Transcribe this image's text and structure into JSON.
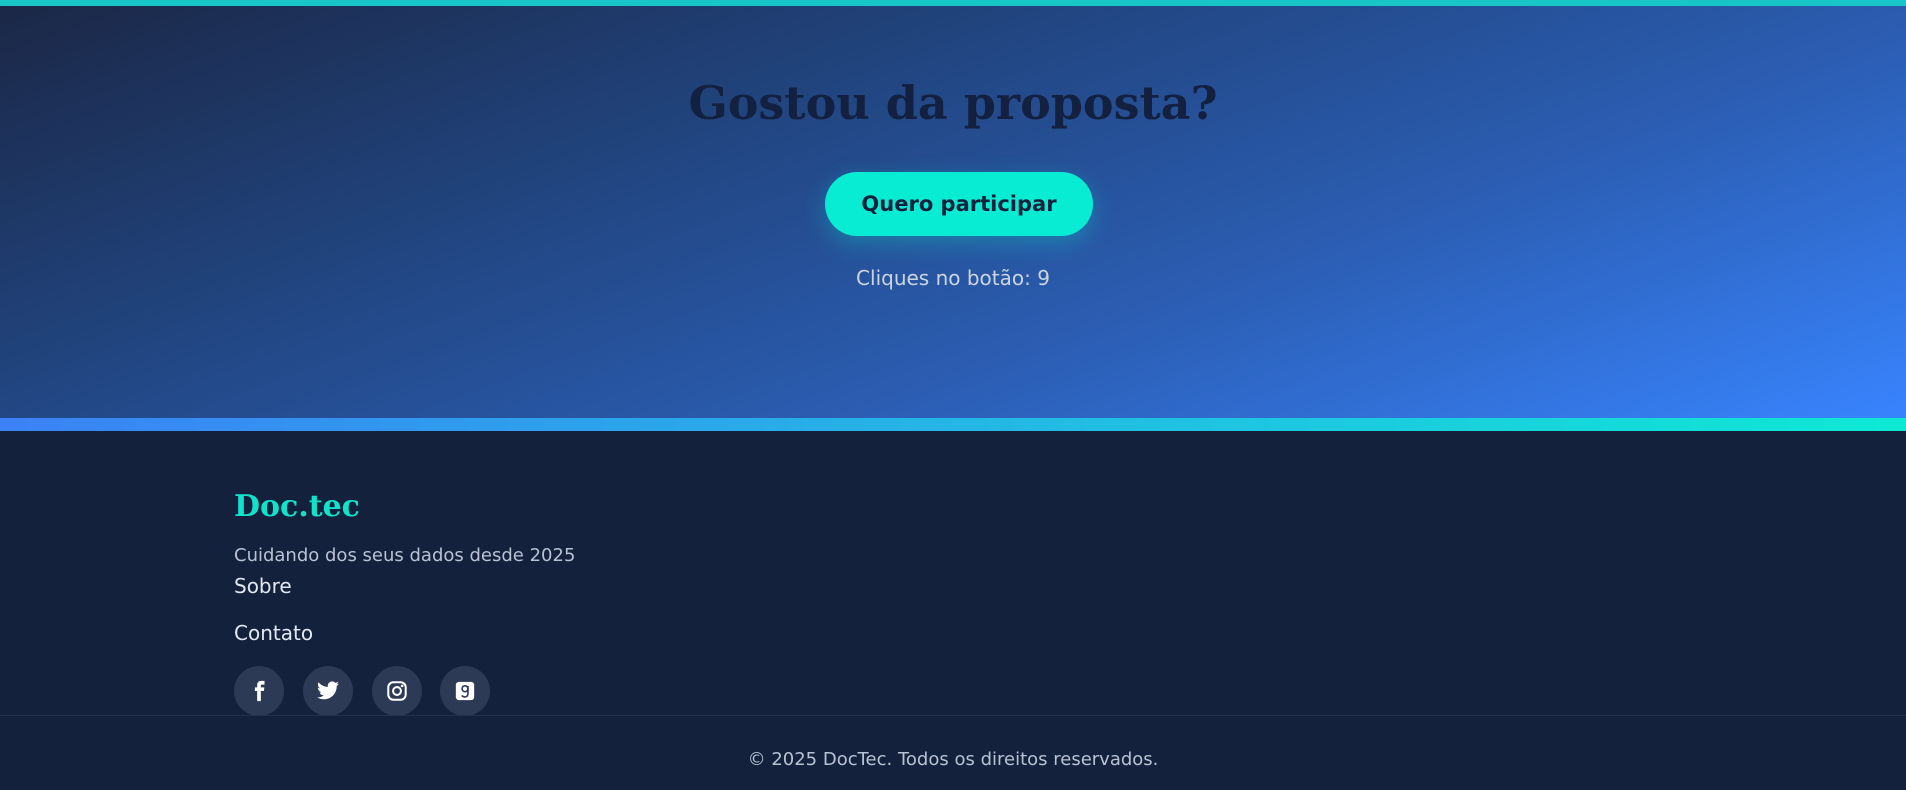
{
  "hero": {
    "title": "Gostou da proposta?",
    "button_label": "Quero participar",
    "clicks_text": "Cliques no botão: 9"
  },
  "footer": {
    "brand": "Doc.tec",
    "tagline": "Cuidando dos seus dados desde 2025",
    "links": [
      "Sobre",
      "Contato"
    ],
    "social": [
      {
        "icon": "facebook-icon"
      },
      {
        "icon": "twitter-icon"
      },
      {
        "icon": "instagram-icon"
      },
      {
        "icon": "goodreads-icon"
      }
    ],
    "copyright": "© 2025 DocTec. Todos os direitos reservados."
  },
  "colors": {
    "accent": "#08ecd4",
    "hero_gradient_start": "#1b2746",
    "hero_gradient_end": "#3884fe",
    "footer_bg": "#14213d",
    "top_line": "#19c6c7"
  }
}
